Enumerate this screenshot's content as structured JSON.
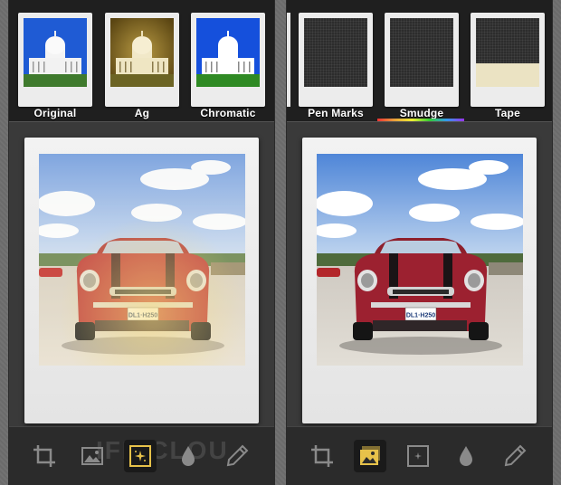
{
  "left_screen": {
    "filters": [
      {
        "label": "Original",
        "style": "original"
      },
      {
        "label": "Ag",
        "style": "ag"
      },
      {
        "label": "Chromatic",
        "style": "chromatic"
      }
    ],
    "toolbar": [
      {
        "icon": "crop-icon",
        "active": false
      },
      {
        "icon": "picture-icon",
        "active": false
      },
      {
        "icon": "sparkle-icon",
        "active": true
      },
      {
        "icon": "droplet-icon",
        "active": false
      },
      {
        "icon": "pen-icon",
        "active": false
      }
    ],
    "watermark": "IFE  CLOU"
  },
  "right_screen": {
    "frames": [
      {
        "label": "Pen Marks",
        "style": "pen-marks"
      },
      {
        "label": "Smudge",
        "style": "smudge"
      },
      {
        "label": "Tape",
        "style": "tape"
      }
    ],
    "toolbar": [
      {
        "icon": "crop-icon",
        "active": false
      },
      {
        "icon": "picture-icon",
        "active": true
      },
      {
        "icon": "sparkle-icon",
        "active": false
      },
      {
        "icon": "droplet-icon",
        "active": false
      },
      {
        "icon": "pen-icon",
        "active": false
      }
    ]
  },
  "photo": {
    "license_plate": "DL1·H250"
  },
  "colors": {
    "accent_active": "#e7c24a",
    "tool_inactive": "#8a8a8a"
  }
}
